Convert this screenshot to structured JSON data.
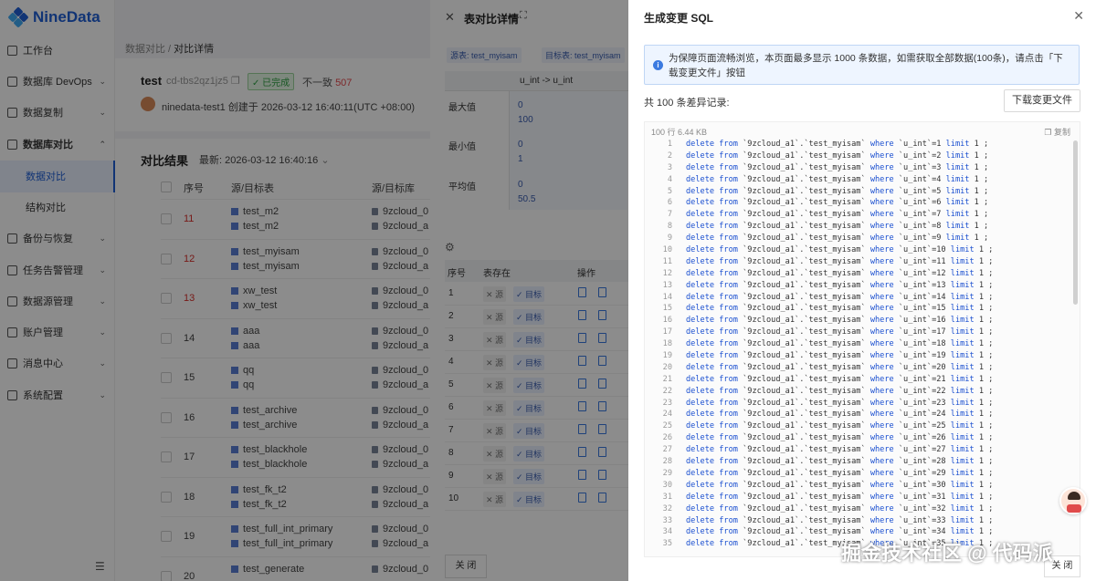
{
  "app": {
    "logo": "NineData"
  },
  "sidebar": {
    "items": [
      {
        "label": "工作台",
        "chev": ""
      },
      {
        "label": "数据库 DevOps",
        "chev": "⌄"
      },
      {
        "label": "数据复制",
        "chev": "⌄"
      },
      {
        "label": "数据库对比",
        "chev": "⌃"
      },
      {
        "label": "数据对比",
        "chev": ""
      },
      {
        "label": "结构对比",
        "chev": ""
      },
      {
        "label": "备份与恢复",
        "chev": "⌄"
      },
      {
        "label": "任务告警管理",
        "chev": "⌄"
      },
      {
        "label": "数据源管理",
        "chev": "⌄"
      },
      {
        "label": "账户管理",
        "chev": "⌄"
      },
      {
        "label": "消息中心",
        "chev": "⌄"
      },
      {
        "label": "系统配置",
        "chev": "⌄"
      }
    ]
  },
  "main": {
    "breadcrumb": {
      "parent": "数据对比",
      "sep": " / ",
      "current": "对比详情"
    },
    "task": {
      "name": "test",
      "id": "cd-tbs2qz1jz5",
      "status": "已完成",
      "diff_label": "不一致",
      "diff_count": "507",
      "creator": "ninedata-test1 创建于 2026-03-12 16:40:11(UTC +08:00)"
    },
    "result": {
      "title": "对比结果",
      "latest": "最新:  2026-03-12 16:40:16"
    },
    "columns": [
      "序号",
      "源/目标表",
      "源/目标库"
    ],
    "rows": [
      {
        "no": "11",
        "src": "test_m2",
        "tgt": "test_m2",
        "db1": "9zcloud_0",
        "db2": "9zcloud_a",
        "red": true
      },
      {
        "no": "12",
        "src": "test_myisam",
        "tgt": "test_myisam",
        "db1": "9zcloud_0",
        "db2": "9zcloud_a",
        "red": true
      },
      {
        "no": "13",
        "src": "xw_test",
        "tgt": "xw_test",
        "db1": "9zcloud_0",
        "db2": "9zcloud_a",
        "red": true
      },
      {
        "no": "14",
        "src": "aaa",
        "tgt": "aaa",
        "db1": "9zcloud_0",
        "db2": "9zcloud_a",
        "red": false
      },
      {
        "no": "15",
        "src": "qq",
        "tgt": "qq",
        "db1": "9zcloud_0",
        "db2": "9zcloud_a",
        "red": false
      },
      {
        "no": "16",
        "src": "test_archive",
        "tgt": "test_archive",
        "db1": "9zcloud_0",
        "db2": "9zcloud_a",
        "red": false
      },
      {
        "no": "17",
        "src": "test_blackhole",
        "tgt": "test_blackhole",
        "db1": "9zcloud_0",
        "db2": "9zcloud_a",
        "red": false
      },
      {
        "no": "18",
        "src": "test_fk_t2",
        "tgt": "test_fk_t2",
        "db1": "9zcloud_0",
        "db2": "9zcloud_a",
        "red": false
      },
      {
        "no": "19",
        "src": "test_full_int_primary",
        "tgt": "test_full_int_primary",
        "db1": "9zcloud_0",
        "db2": "9zcloud_a",
        "red": false
      },
      {
        "no": "20",
        "src": "test_generate",
        "tgt": "",
        "db1": "9zcloud_0",
        "db2": "",
        "red": false
      }
    ]
  },
  "compare": {
    "title": "表对比详情",
    "src_tag": "源表: test_myisam",
    "tgt_tag": "目标表: test_myisam",
    "col_header": "u_int -> u_int",
    "stats": [
      {
        "label": "最大值",
        "v1": "0",
        "v2": "100"
      },
      {
        "label": "最小值",
        "v1": "0",
        "v2": "1"
      },
      {
        "label": "平均值",
        "v1": "0",
        "v2": "50.5"
      }
    ],
    "list_headers": {
      "no": "序号",
      "exists": "表存在",
      "op": "操作"
    },
    "pill_src": "✕ 源",
    "pill_tgt": "✓ 目标",
    "list_rows": [
      "1",
      "2",
      "3",
      "4",
      "5",
      "6",
      "7",
      "8",
      "9",
      "10"
    ],
    "close_btn": "关 闭"
  },
  "sql": {
    "title": "生成变更 SQL",
    "info": "为保障页面流畅浏览，本页面最多显示 1000 条数据，如需获取全部数据(100条)，请点击「下载变更文件」按钮",
    "count": "共 100 条差异记录:",
    "download_btn": "下载变更文件",
    "meta": "100 行   6.44 KB",
    "copy": "复制",
    "close_btn": "关 闭",
    "line_prefix": "delete from `9zcloud_a1`.`test_myisam` where `u_int`=",
    "line_suffix": " limit 1 ;",
    "line_count": 35
  },
  "watermark": "掘金技术社区 @ 代码派"
}
